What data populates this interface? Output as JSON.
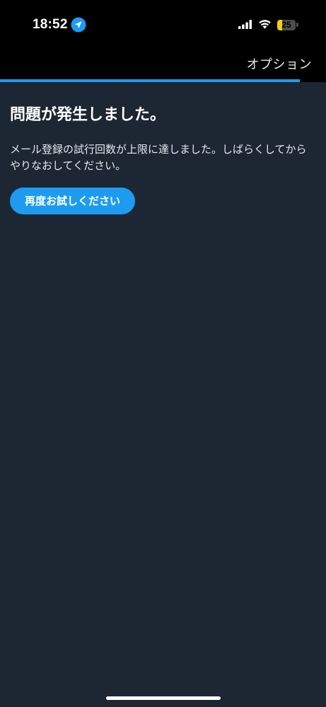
{
  "status_bar": {
    "time": "18:52",
    "battery_level": "25",
    "battery_fraction": 0.25,
    "battery_color": "#f4cf0b",
    "icons": [
      "location-arrow-icon",
      "cellular-signal-icon",
      "wifi-icon",
      "battery-icon"
    ]
  },
  "header": {
    "options_label": "オプション",
    "progress_fraction": 0.92,
    "accent_color": "#1d9bf0"
  },
  "error": {
    "title": "問題が発生しました。",
    "message": "メール登録の試行回数が上限に達しました。しばらくしてからやりなおしてください。",
    "retry_label": "再度お試しください"
  },
  "colors": {
    "background": "#1c2733",
    "top_bar": "#000000",
    "button": "#1d9bf0"
  }
}
